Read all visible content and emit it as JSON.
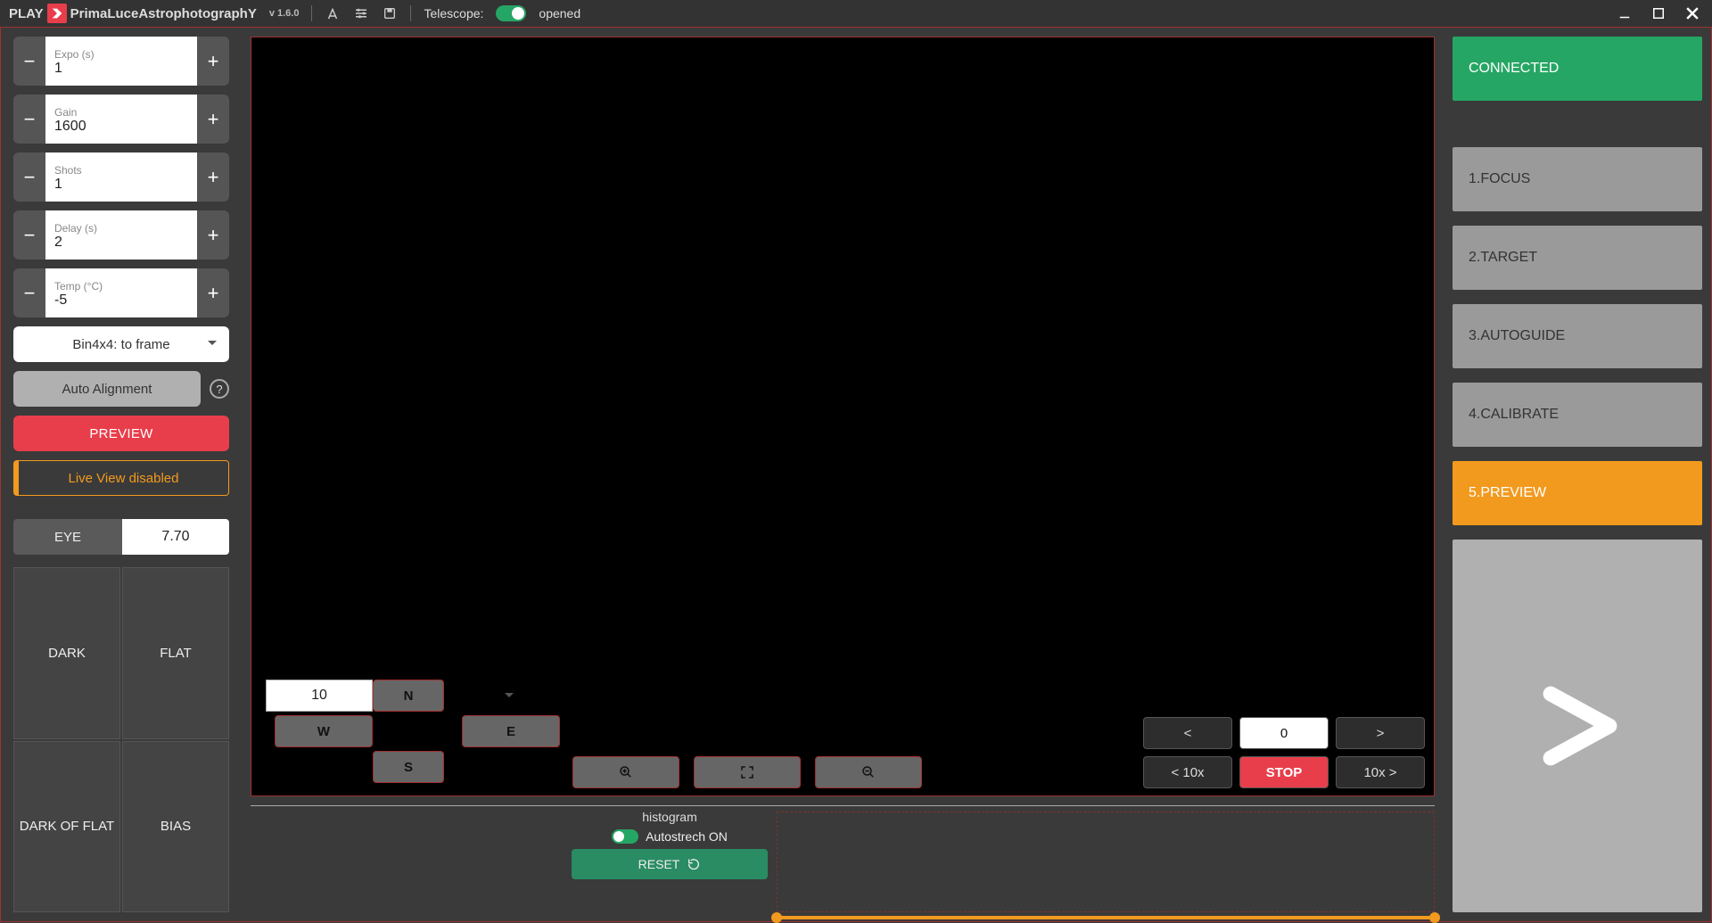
{
  "top": {
    "play": "PLAY",
    "brand": "PrimaLuceAstrophotographY",
    "version": "v 1.6.0",
    "telescope_label": "Telescope:",
    "telescope_state": "opened"
  },
  "params": {
    "expo": {
      "label": "Expo (s)",
      "value": "1"
    },
    "gain": {
      "label": "Gain",
      "value": "1600"
    },
    "shots": {
      "label": "Shots",
      "value": "1"
    },
    "delay": {
      "label": "Delay (s)",
      "value": "2"
    },
    "temp": {
      "label": "Temp (°C)",
      "value": "-5"
    }
  },
  "binning": "Bin4x4: to frame",
  "auto_alignment": "Auto Alignment",
  "preview_btn": "PREVIEW",
  "liveview": "Live View disabled",
  "eye": {
    "label": "EYE",
    "value": "7.70"
  },
  "frames": {
    "dark": "DARK",
    "flat": "FLAT",
    "dof": "DARK OF FLAT",
    "bias": "BIAS"
  },
  "dpad": {
    "n": "N",
    "s": "S",
    "e": "E",
    "w": "W",
    "speed": "10"
  },
  "zstack": {
    "left": "<",
    "center": "0",
    "right": ">",
    "l10": "< 10x",
    "stop": "STOP",
    "r10": "10x >"
  },
  "hist": {
    "title": "histogram",
    "auto": "Autostrech ON",
    "reset": "RESET"
  },
  "steps": {
    "connected": "CONNECTED",
    "focus": "1.FOCUS",
    "target": "2.TARGET",
    "autoguide": "3.AUTOGUIDE",
    "calibrate": "4.CALIBRATE",
    "preview": "5.PREVIEW"
  }
}
